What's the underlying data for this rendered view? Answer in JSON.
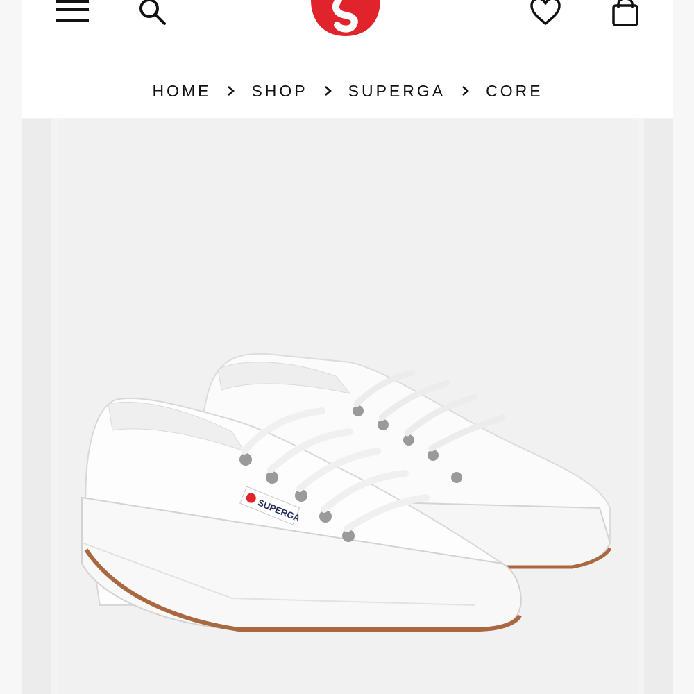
{
  "header": {
    "icons": {
      "menu": "hamburger-menu-icon",
      "search": "search-icon",
      "logo": "superga-logo",
      "wishlist": "heart-icon",
      "bag": "shopping-bag-icon"
    }
  },
  "breadcrumb": {
    "items": [
      "HOME",
      "SHOP",
      "SUPERGA",
      "CORE"
    ]
  },
  "product_image": {
    "label": "SUPERGA",
    "subject": "white canvas sneakers"
  },
  "colors": {
    "brand_red": "#e1242b",
    "background": "#f3f3f3",
    "text": "#111111",
    "sole_gum": "#a9683f"
  }
}
